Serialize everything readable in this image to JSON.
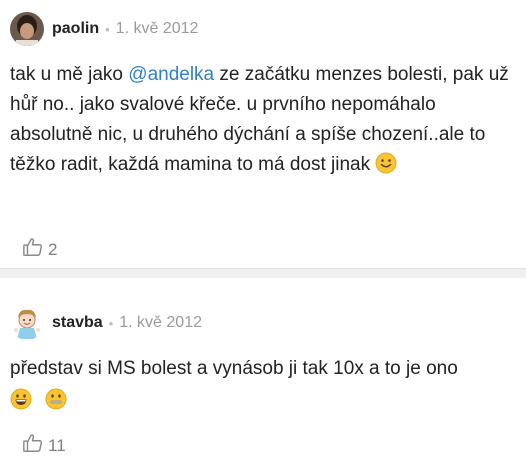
{
  "posts": [
    {
      "username": "paolin",
      "date": "1. kvě 2012",
      "text_before": "tak u mě jako ",
      "mention": "@andelka",
      "text_after": " ze začátku menzes bolesti, pak už hůř no.. jako svalové křeče. u prvního nepomáhalo absolutně nic, u druhého dýchání a spíše chození..ale to těžko radit, každá mamina to má dost jinak",
      "emojis": [
        "slightly-smiling-face"
      ],
      "likes": "2"
    },
    {
      "username": "stavba",
      "date": "1. kvě 2012",
      "text": "představ si MS bolest a vynásob ji tak 10x a to je ono",
      "emojis": [
        "grinning-face",
        "zipper-mouth-face"
      ],
      "likes": "11"
    }
  ],
  "colors": {
    "mention": "#2f80c8",
    "meta": "#9a9a9a",
    "divider": "#f0f0f0",
    "emoji": "#f7c531"
  }
}
